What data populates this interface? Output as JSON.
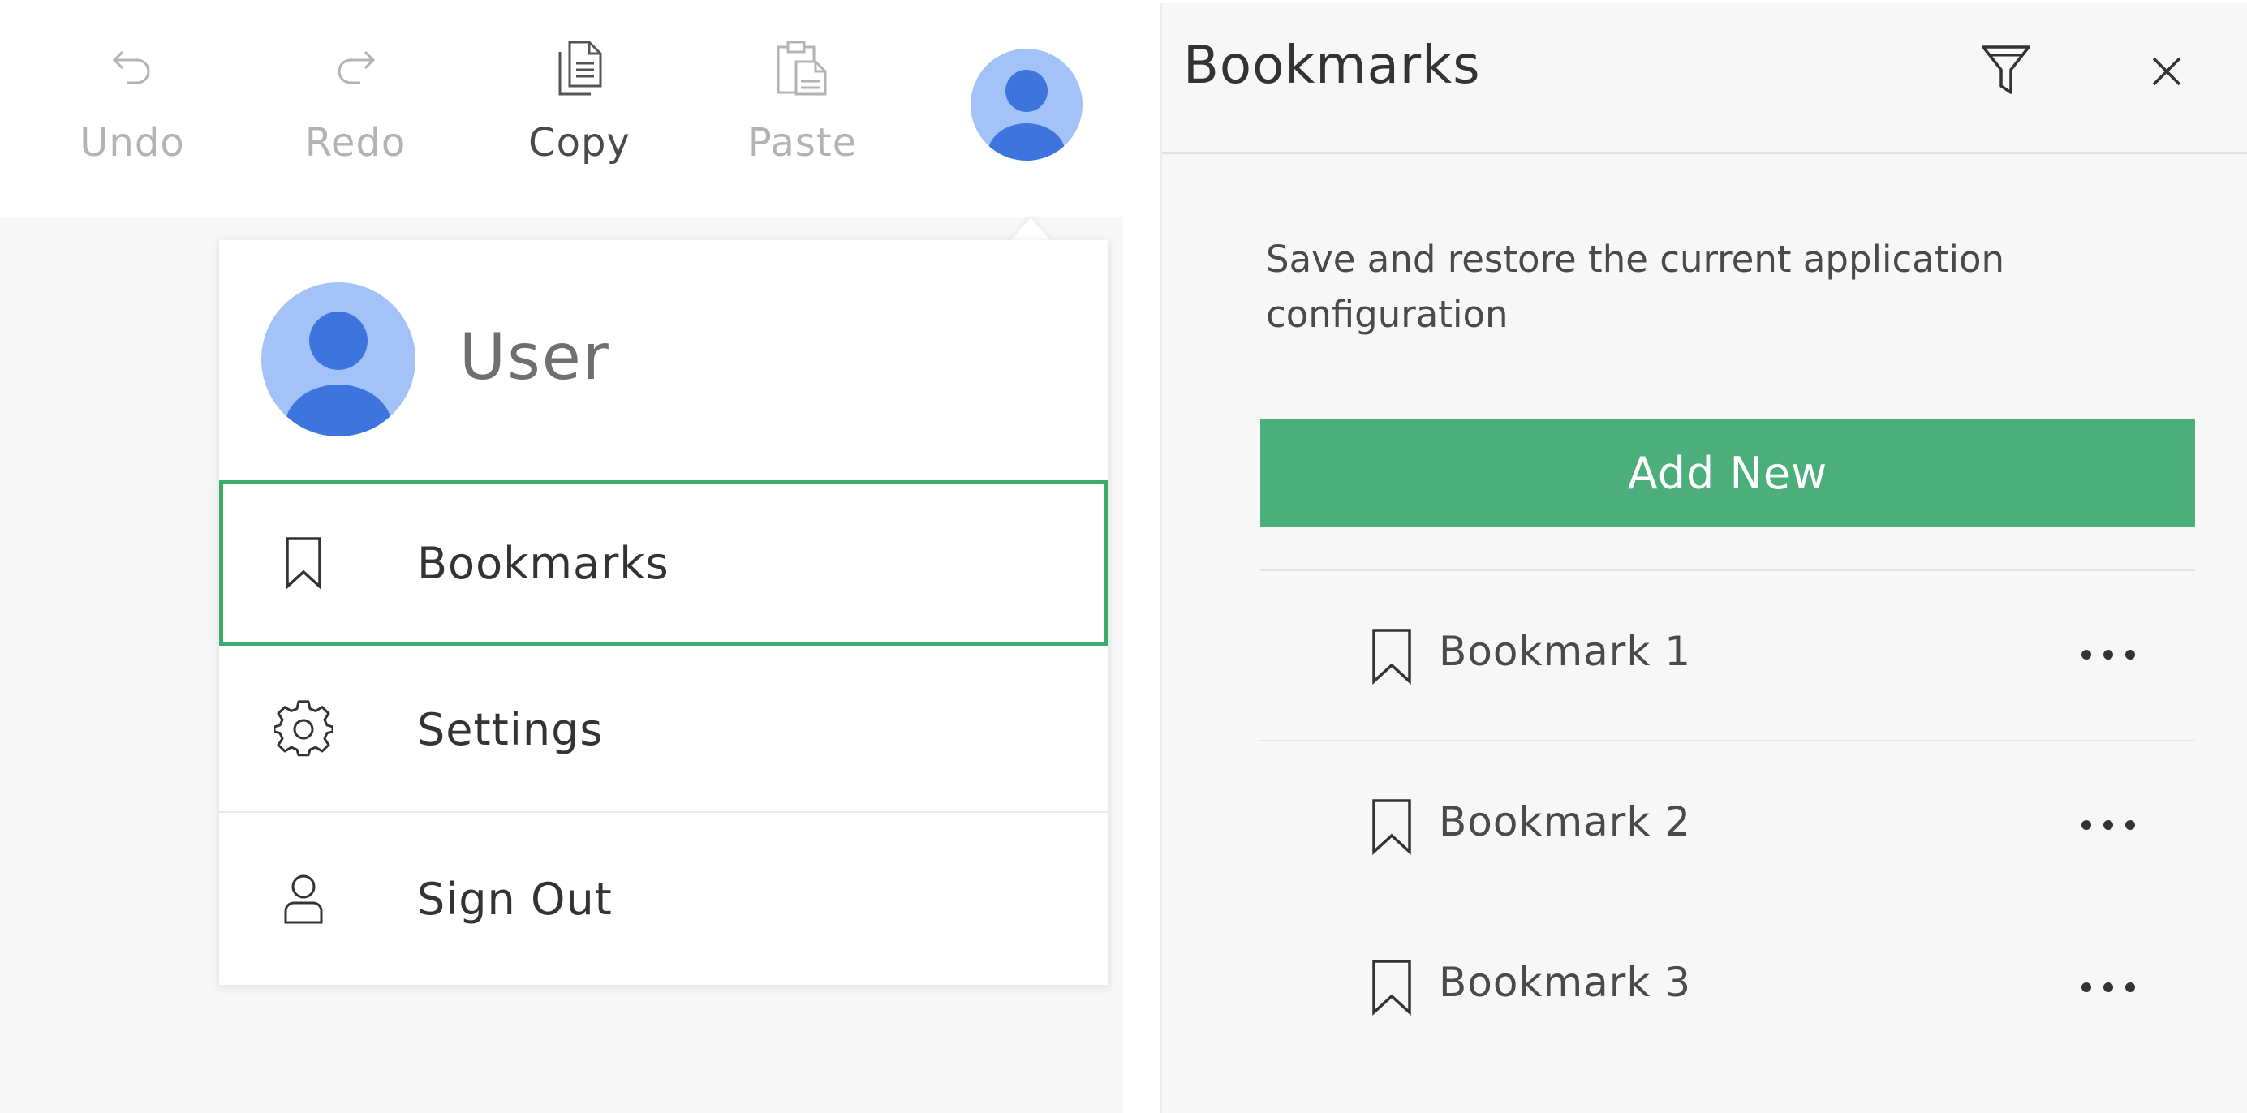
{
  "toolbar": {
    "undo_label": "Undo",
    "redo_label": "Redo",
    "copy_label": "Copy",
    "paste_label": "Paste"
  },
  "user_menu": {
    "user_name": "User",
    "items": [
      {
        "label": "Bookmarks",
        "icon": "bookmark-icon"
      },
      {
        "label": "Settings",
        "icon": "gear-icon"
      },
      {
        "label": "Sign Out",
        "icon": "person-icon"
      }
    ]
  },
  "bookmarks_panel": {
    "title": "Bookmarks",
    "description": "Save and restore the current application configuration",
    "add_button_label": "Add New",
    "items": [
      {
        "label": "Bookmark 1"
      },
      {
        "label": "Bookmark 2"
      },
      {
        "label": "Bookmark 3"
      }
    ]
  },
  "colors": {
    "accent_green": "#4caf7b",
    "focus_border": "#3dab6d",
    "avatar_light": "#a3c2f7",
    "avatar_dark": "#3e74dd"
  }
}
